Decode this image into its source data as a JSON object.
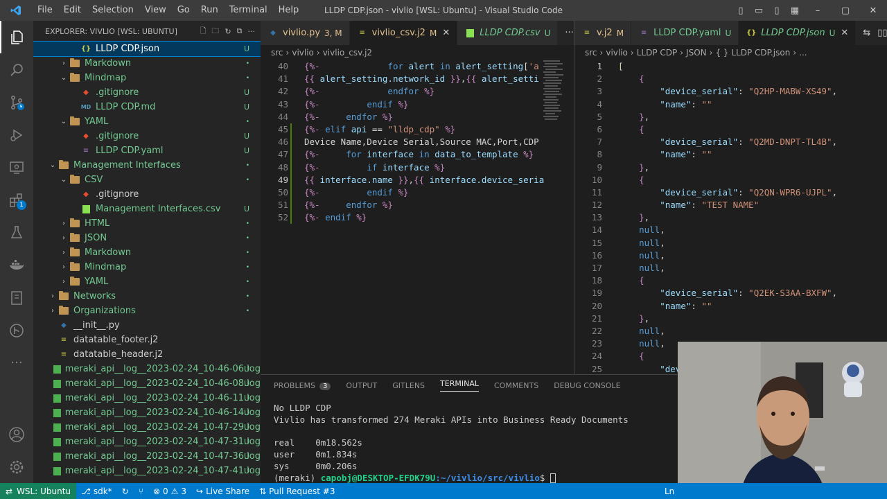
{
  "menu": [
    "File",
    "Edit",
    "Selection",
    "View",
    "Go",
    "Run",
    "Terminal",
    "Help"
  ],
  "window_title": "LLDP CDP.json - vivlio [WSL: Ubuntu] - Visual Studio Code",
  "explorer": {
    "header": "EXPLORER: VIVLIO [WSL: UBUNTU]",
    "items": [
      {
        "label": "LLDP CDP.json",
        "indent": 3,
        "type": "json",
        "deco": "U",
        "selected": true
      },
      {
        "label": "Markdown",
        "indent": 2,
        "type": "folder",
        "chev": "›",
        "deco": "•"
      },
      {
        "label": "Mindmap",
        "indent": 2,
        "type": "folder",
        "chev": "⌄",
        "deco": "•"
      },
      {
        "label": ".gitignore",
        "indent": 3,
        "type": "git",
        "deco": "U"
      },
      {
        "label": "LLDP CDP.md",
        "indent": 3,
        "type": "md",
        "deco": "U"
      },
      {
        "label": "YAML",
        "indent": 2,
        "type": "folder",
        "chev": "⌄",
        "deco": "•"
      },
      {
        "label": ".gitignore",
        "indent": 3,
        "type": "git",
        "deco": "U"
      },
      {
        "label": "LLDP CDP.yaml",
        "indent": 3,
        "type": "yaml",
        "deco": "U"
      },
      {
        "label": "Management Interfaces",
        "indent": 1,
        "type": "folder",
        "chev": "⌄",
        "deco": "•"
      },
      {
        "label": "CSV",
        "indent": 2,
        "type": "folder",
        "chev": "⌄",
        "deco": "•"
      },
      {
        "label": ".gitignore",
        "indent": 3,
        "type": "git",
        "deco": ""
      },
      {
        "label": "Management Interfaces.csv",
        "indent": 3,
        "type": "csv",
        "deco": "U"
      },
      {
        "label": "HTML",
        "indent": 2,
        "type": "folder",
        "chev": "›",
        "deco": "•"
      },
      {
        "label": "JSON",
        "indent": 2,
        "type": "folder",
        "chev": "›",
        "deco": "•"
      },
      {
        "label": "Markdown",
        "indent": 2,
        "type": "folder",
        "chev": "›",
        "deco": "•"
      },
      {
        "label": "Mindmap",
        "indent": 2,
        "type": "folder",
        "chev": "›",
        "deco": "•"
      },
      {
        "label": "YAML",
        "indent": 2,
        "type": "folder",
        "chev": "›",
        "deco": "•"
      },
      {
        "label": "Networks",
        "indent": 1,
        "type": "folder",
        "chev": "›",
        "deco": "•"
      },
      {
        "label": "Organizations",
        "indent": 1,
        "type": "folder",
        "chev": "›",
        "deco": "•"
      },
      {
        "label": "__init__.py",
        "indent": 1,
        "type": "py",
        "deco": ""
      },
      {
        "label": "datatable_footer.j2",
        "indent": 1,
        "type": "j2",
        "deco": ""
      },
      {
        "label": "datatable_header.j2",
        "indent": 1,
        "type": "j2",
        "deco": ""
      },
      {
        "label": "meraki_api__log__2023-02-24_10-46-06.log",
        "indent": 1,
        "type": "log",
        "deco": "U"
      },
      {
        "label": "meraki_api__log__2023-02-24_10-46-08.log",
        "indent": 1,
        "type": "log",
        "deco": "U"
      },
      {
        "label": "meraki_api__log__2023-02-24_10-46-11.log",
        "indent": 1,
        "type": "log",
        "deco": "U"
      },
      {
        "label": "meraki_api__log__2023-02-24_10-46-14.log",
        "indent": 1,
        "type": "log",
        "deco": "U"
      },
      {
        "label": "meraki_api__log__2023-02-24_10-47-29.log",
        "indent": 1,
        "type": "log",
        "deco": "U"
      },
      {
        "label": "meraki_api__log__2023-02-24_10-47-31.log",
        "indent": 1,
        "type": "log",
        "deco": "U"
      },
      {
        "label": "meraki_api__log__2023-02-24_10-47-36.log",
        "indent": 1,
        "type": "log",
        "deco": "U"
      },
      {
        "label": "meraki_api__log__2023-02-24_10-47-41.log",
        "indent": 1,
        "type": "log",
        "deco": "U"
      }
    ]
  },
  "editor1": {
    "tabs": [
      {
        "label": "vivlio.py",
        "suffix": "3, M",
        "type": "py"
      },
      {
        "label": "vivlio_csv.j2",
        "suffix": "M",
        "type": "j2",
        "active": true
      },
      {
        "label": "LLDP CDP.csv",
        "suffix": "U",
        "type": "csv"
      }
    ],
    "crumbs": [
      "src",
      "vivlio",
      "vivlio_csv.j2"
    ],
    "lines": [
      {
        "n": "40",
        "html": "<span class='k'>{%-</span>             <span class='kw'>for</span> <span class='v'>alert</span> <span class='kw'>in</span> <span class='v'>alert_setting</span><span class='t'>[</span><span class='s'>'a</span>"
      },
      {
        "n": "41",
        "html": "<span class='k'>{{</span> <span class='v'>alert_setting.network_id</span> <span class='k'>}}</span><span class='t'>,</span><span class='k'>{{</span> <span class='v'>alert_setti</span>"
      },
      {
        "n": "42",
        "html": "<span class='k'>{%-</span>             <span class='kw'>endfor</span> <span class='k'>%}</span>"
      },
      {
        "n": "43",
        "html": "<span class='k'>{%-</span>         <span class='kw'>endif</span> <span class='k'>%}</span>"
      },
      {
        "n": "44",
        "html": "<span class='k'>{%-</span>     <span class='kw'>endfor</span> <span class='k'>%}</span>"
      },
      {
        "n": "45",
        "html": "<span class='k'>{%-</span> <span class='kw'>elif</span> <span class='v'>api</span> <span class='t'>==</span> <span class='s'>\"lldp_cdp\"</span> <span class='k'>%}</span>"
      },
      {
        "n": "46",
        "html": "<span class='t'>Device Name,Device Serial,Source MAC,Port,CDP</span>"
      },
      {
        "n": "47",
        "html": "<span class='k'>{%-</span>     <span class='kw'>for</span> <span class='v'>interface</span> <span class='kw'>in</span> <span class='v'>data_to_template</span> <span class='k'>%}</span>"
      },
      {
        "n": "48",
        "html": "<span class='k'>{%-</span>         <span class='kw'>if</span> <span class='v'>interface</span> <span class='k'>%}</span>"
      },
      {
        "n": "49",
        "html": "<span class='k'>{{</span> <span class='v'>interface.name</span> <span class='k'>}}</span><span class='t'>,</span><span class='k'>{{</span> <span class='v'>interface.device_seria</span>",
        "cur": true
      },
      {
        "n": "50",
        "html": "<span class='k'>{%-</span>         <span class='kw'>endif</span> <span class='k'>%}</span>"
      },
      {
        "n": "51",
        "html": "<span class='k'>{%-</span>     <span class='kw'>endfor</span> <span class='k'>%}</span>"
      },
      {
        "n": "52",
        "html": "<span class='k'>{%-</span> <span class='kw'>endif</span> <span class='k'>%}</span>"
      }
    ]
  },
  "editor2": {
    "tabs": [
      {
        "label": "v.j2",
        "suffix": "M",
        "type": "j2"
      },
      {
        "label": "LLDP CDP.yaml",
        "suffix": "U",
        "type": "yaml"
      },
      {
        "label": "LLDP CDP.json",
        "suffix": "U",
        "type": "json",
        "active": true
      }
    ],
    "crumbs": [
      "src",
      "vivlio",
      "LLDP CDP",
      "JSON",
      "{ } LLDP CDP.json",
      "..."
    ],
    "lines": [
      {
        "n": "1",
        "html": "<span class='y'>[</span>",
        "cur": true
      },
      {
        "n": "2",
        "html": "    <span class='k'>{</span>"
      },
      {
        "n": "3",
        "html": "        <span class='prop'>\"device_serial\"</span><span class='t'>: </span><span class='str'>\"Q2HP-MABW-XS49\"</span><span class='t'>,</span>"
      },
      {
        "n": "4",
        "html": "        <span class='prop'>\"name\"</span><span class='t'>: </span><span class='str'>\"\"</span>"
      },
      {
        "n": "5",
        "html": "    <span class='k'>}</span><span class='t'>,</span>"
      },
      {
        "n": "6",
        "html": "    <span class='k'>{</span>"
      },
      {
        "n": "7",
        "html": "        <span class='prop'>\"device_serial\"</span><span class='t'>: </span><span class='str'>\"Q2MD-DNPT-TL4B\"</span><span class='t'>,</span>"
      },
      {
        "n": "8",
        "html": "        <span class='prop'>\"name\"</span><span class='t'>: </span><span class='str'>\"\"</span>"
      },
      {
        "n": "9",
        "html": "    <span class='k'>}</span><span class='t'>,</span>"
      },
      {
        "n": "10",
        "html": "    <span class='k'>{</span>"
      },
      {
        "n": "11",
        "html": "        <span class='prop'>\"device_serial\"</span><span class='t'>: </span><span class='str'>\"Q2QN-WPR6-UJPL\"</span><span class='t'>,</span>"
      },
      {
        "n": "12",
        "html": "        <span class='prop'>\"name\"</span><span class='t'>: </span><span class='str'>\"TEST NAME\"</span>"
      },
      {
        "n": "13",
        "html": "    <span class='k'>}</span><span class='t'>,</span>"
      },
      {
        "n": "14",
        "html": "    <span class='kw'>null</span><span class='t'>,</span>"
      },
      {
        "n": "15",
        "html": "    <span class='kw'>null</span><span class='t'>,</span>"
      },
      {
        "n": "16",
        "html": "    <span class='kw'>null</span><span class='t'>,</span>"
      },
      {
        "n": "17",
        "html": "    <span class='kw'>null</span><span class='t'>,</span>"
      },
      {
        "n": "18",
        "html": "    <span class='k'>{</span>"
      },
      {
        "n": "19",
        "html": "        <span class='prop'>\"device_serial\"</span><span class='t'>: </span><span class='str'>\"Q2EK-S3AA-BXFW\"</span><span class='t'>,</span>"
      },
      {
        "n": "20",
        "html": "        <span class='prop'>\"name\"</span><span class='t'>: </span><span class='str'>\"\"</span>"
      },
      {
        "n": "21",
        "html": "    <span class='k'>}</span><span class='t'>,</span>"
      },
      {
        "n": "22",
        "html": "    <span class='kw'>null</span><span class='t'>,</span>"
      },
      {
        "n": "23",
        "html": "    <span class='kw'>null</span><span class='t'>,</span>"
      },
      {
        "n": "24",
        "html": "    <span class='k'>{</span>"
      },
      {
        "n": "25",
        "html": "        <span class='prop'>\"dev</span>"
      }
    ]
  },
  "panel": {
    "tabs": [
      {
        "label": "PROBLEMS",
        "count": "3"
      },
      {
        "label": "OUTPUT"
      },
      {
        "label": "GITLENS"
      },
      {
        "label": "TERMINAL",
        "active": true
      },
      {
        "label": "COMMENTS"
      },
      {
        "label": "DEBUG CONSOLE"
      }
    ],
    "terminal": [
      "No LLDP CDP",
      "Vivlio has transformed 274 Meraki APIs into Business Ready Documents",
      "",
      "real    0m18.562s",
      "user    0m1.834s",
      "sys     0m0.206s"
    ],
    "prompt_env": "(meraki)",
    "prompt_user": "capobj@DESKTOP-EFDK79U",
    "prompt_path": ":~/vivlio/src/vivlio",
    "prompt_sym": "$"
  },
  "status": {
    "remote": "WSL: Ubuntu",
    "branch": "sdk*",
    "errors": "0",
    "warnings": "3",
    "liveshare": "Live Share",
    "pr": "Pull Request #3",
    "ln": "Ln"
  },
  "colors": {
    "statusbar": "#007acc",
    "remote": "#16825d",
    "accent": "#007fd4"
  }
}
